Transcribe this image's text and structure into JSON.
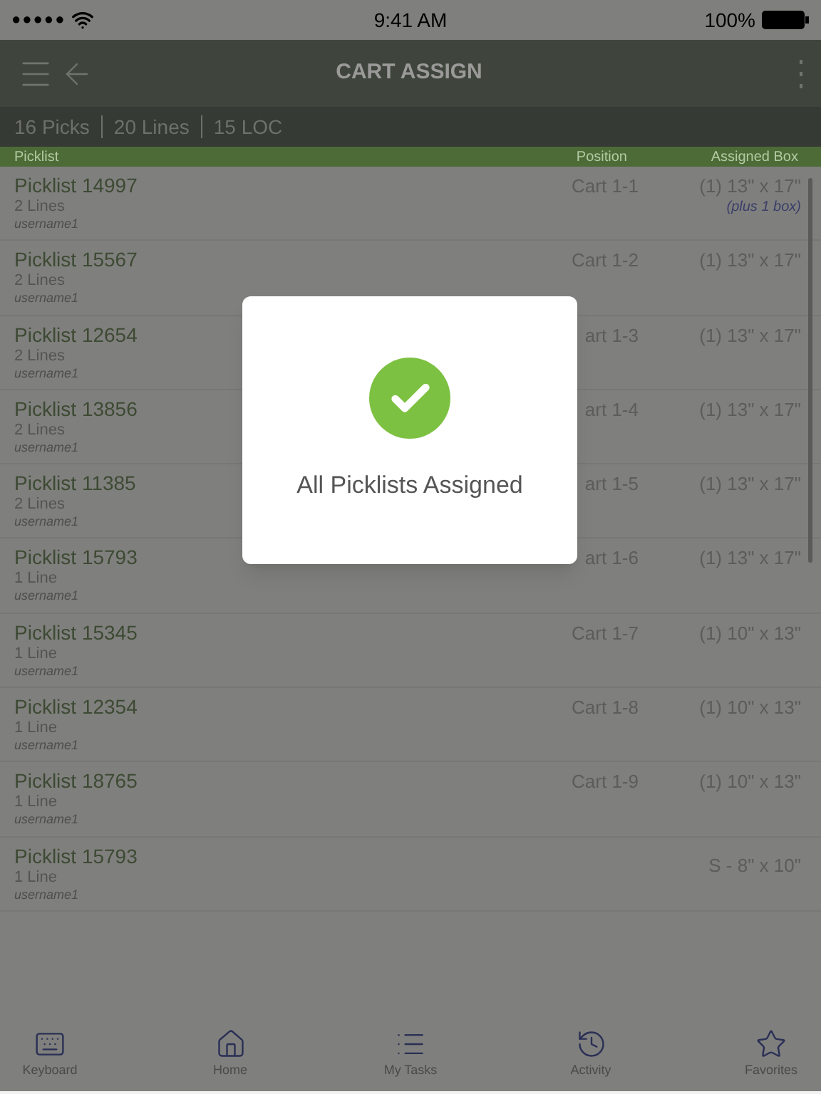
{
  "status_bar": {
    "signal_dots": "●●●●●",
    "time": "9:41 AM",
    "battery": "100%"
  },
  "header": {
    "title": "CART ASSIGN"
  },
  "summary": [
    "16 Picks",
    "20 Lines",
    "15 LOC"
  ],
  "columns": [
    "Picklist",
    "Position",
    "Assigned Box"
  ],
  "rows": [
    {
      "name": "Picklist 14997",
      "lines": "2 Lines",
      "user": "username1",
      "position": "Cart 1-1",
      "box": "(1) 13\" x 17\"",
      "note": "(plus 1 box)"
    },
    {
      "name": "Picklist 15567",
      "lines": "2 Lines",
      "user": "username1",
      "position": "Cart 1-2",
      "box": "(1) 13\" x 17\""
    },
    {
      "name": "Picklist 12654",
      "lines": "2 Lines",
      "user": "username1",
      "position": "art 1-3",
      "box": "(1) 13\" x 17\""
    },
    {
      "name": "Picklist 13856",
      "lines": "2 Lines",
      "user": "username1",
      "position": "art 1-4",
      "box": "(1) 13\" x 17\""
    },
    {
      "name": "Picklist 11385",
      "lines": "2 Lines",
      "user": "username1",
      "position": "art 1-5",
      "box": "(1) 13\" x 17\""
    },
    {
      "name": "Picklist 15793",
      "lines": "1 Line",
      "user": "username1",
      "position": "art 1-6",
      "box": "(1) 13\" x 17\""
    },
    {
      "name": "Picklist 15345",
      "lines": "1 Line",
      "user": "username1",
      "position": "Cart 1-7",
      "box": "(1) 10\" x 13\""
    },
    {
      "name": "Picklist 12354",
      "lines": "1 Line",
      "user": "username1",
      "position": "Cart 1-8",
      "box": "(1) 10\" x 13\""
    },
    {
      "name": "Picklist 18765",
      "lines": "1 Line",
      "user": "username1",
      "position": "Cart 1-9",
      "box": "(1) 10\" x 13\""
    },
    {
      "name": "Picklist 15793",
      "lines": "1 Line",
      "user": "username1",
      "box": "S - 8\" x 10\""
    }
  ],
  "dialog": {
    "message": "All Picklists Assigned"
  },
  "tab_bar": [
    {
      "kind": "keyboard",
      "label": "Keyboard"
    },
    {
      "kind": "home",
      "label": "Home"
    },
    {
      "kind": "tasks",
      "label": "My Tasks"
    },
    {
      "kind": "activity",
      "label": "Activity"
    },
    {
      "kind": "favorites",
      "label": "Favorites"
    }
  ]
}
